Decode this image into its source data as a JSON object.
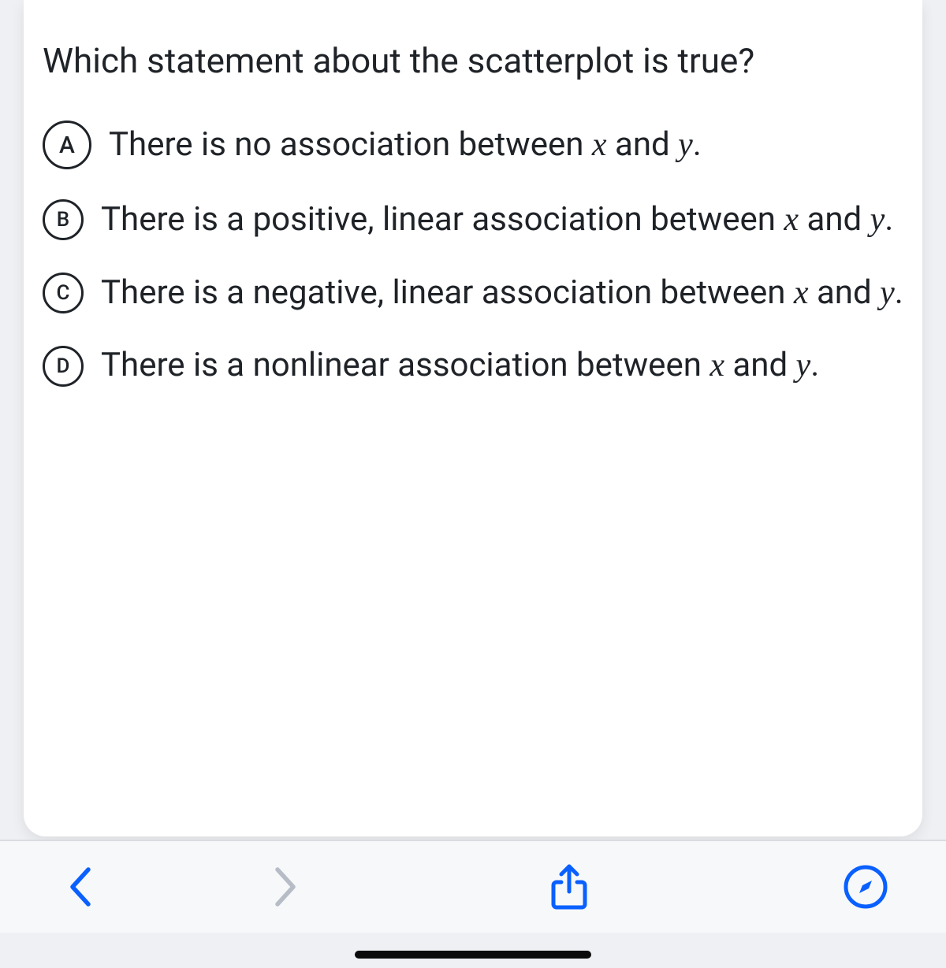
{
  "question": {
    "text": "Which statement about the scatterplot is true?"
  },
  "options": {
    "a": {
      "letter": "A",
      "pre": "There is no association between ",
      "mid": " and ",
      "post": "."
    },
    "b": {
      "letter": "B",
      "pre": "There is a positive, linear association between ",
      "mid": " and ",
      "post": "."
    },
    "c": {
      "letter": "C",
      "pre": "There is a negative, linear association between ",
      "mid": " and ",
      "post": "."
    },
    "d": {
      "letter": "D",
      "pre": "There is a nonlinear association between ",
      "mid": " and ",
      "post": "."
    }
  },
  "vars": {
    "x": "x",
    "y": "y"
  },
  "toolbar": {
    "back": "back",
    "forward": "forward",
    "share": "share",
    "compass": "compass"
  },
  "colors": {
    "accent": "#0a60ff",
    "forward_muted": "#b7bdc6"
  }
}
